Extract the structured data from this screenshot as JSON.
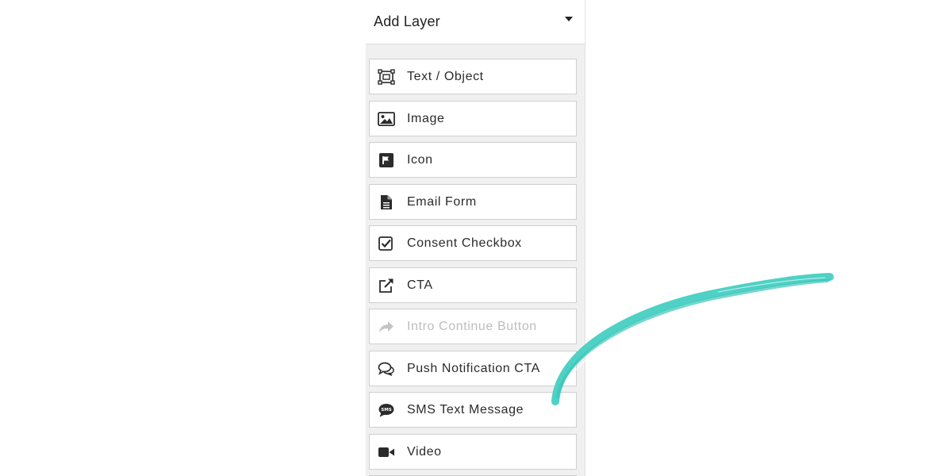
{
  "panel": {
    "title": "Add Layer"
  },
  "layers": [
    {
      "label": "Text / Object",
      "icon": "text-object-icon"
    },
    {
      "label": "Image",
      "icon": "image-icon"
    },
    {
      "label": "Icon",
      "icon": "flag-icon"
    },
    {
      "label": "Email Form",
      "icon": "document-icon"
    },
    {
      "label": "Consent Checkbox",
      "icon": "checkbox-icon"
    },
    {
      "label": "CTA",
      "icon": "external-link-icon"
    },
    {
      "label": "Intro Continue Button",
      "icon": "share-arrow-icon"
    },
    {
      "label": "Push Notification CTA",
      "icon": "chat-bubbles-icon"
    },
    {
      "label": "SMS Text Message",
      "icon": "sms-bubble-icon"
    },
    {
      "label": "Video",
      "icon": "video-camera-icon"
    }
  ],
  "colors": {
    "panel_bg": "#f0f0f0",
    "item_border": "#cfcfcf",
    "text": "#2b2b2b",
    "disabled_text": "#bdbdbd",
    "brush_stroke": "#4fd1c5"
  }
}
